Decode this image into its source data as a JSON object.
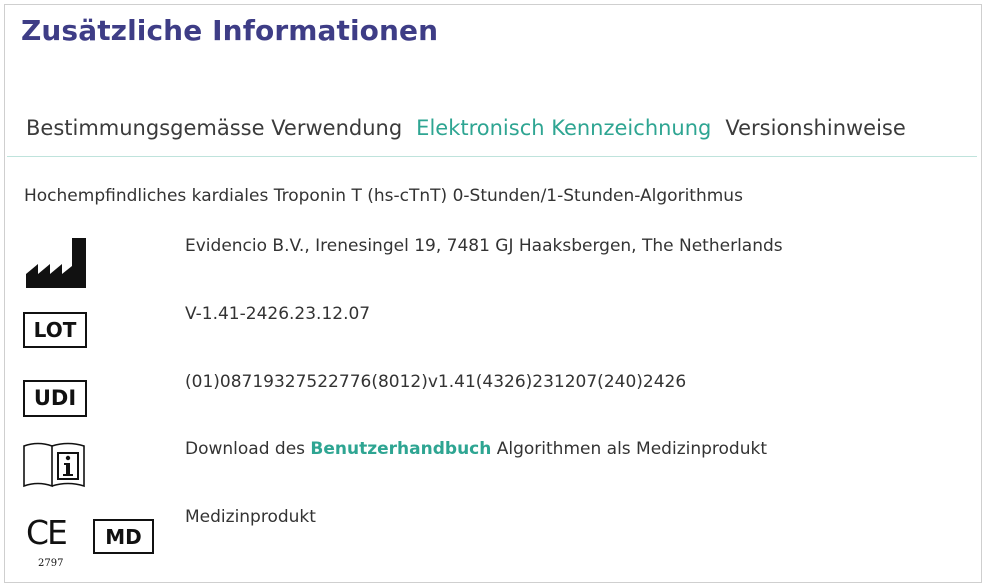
{
  "section": {
    "title": "Zusätzliche Informationen"
  },
  "tabs": [
    {
      "label": "Bestimmungsgemässe Verwendung",
      "active": false
    },
    {
      "label": "Elektronisch Kennzeichnung",
      "active": true
    },
    {
      "label": "Versionshinweise",
      "active": false
    }
  ],
  "content": {
    "intro": "Hochempfindliches kardiales Troponin T (hs-cTnT) 0-Stunden/1-Stunden-Algorithmus",
    "manufacturer": {
      "icon": "manufacturer-icon",
      "text": "Evidencio B.V., Irenesingel 19, 7481 GJ Haaksbergen, The Netherlands"
    },
    "lot": {
      "icon_label": "LOT",
      "text": "V-1.41-2426.23.12.07"
    },
    "udi": {
      "icon_label": "UDI",
      "text": "(01)08719327522776(8012)v1.41(4326)231207(240)2426"
    },
    "ifu": {
      "icon": "instructions-for-use-icon",
      "text_before": "Download des ",
      "link": "Benutzerhandbuch",
      "text_after": " Algorithmen als Medizinprodukt"
    },
    "ce": {
      "mark": "CE",
      "notified_body": "2797",
      "md_label": "MD",
      "text": "Medizinprodukt"
    }
  },
  "colors": {
    "title": "#3e3d86",
    "accent": "#2ea592",
    "text": "#333333"
  }
}
